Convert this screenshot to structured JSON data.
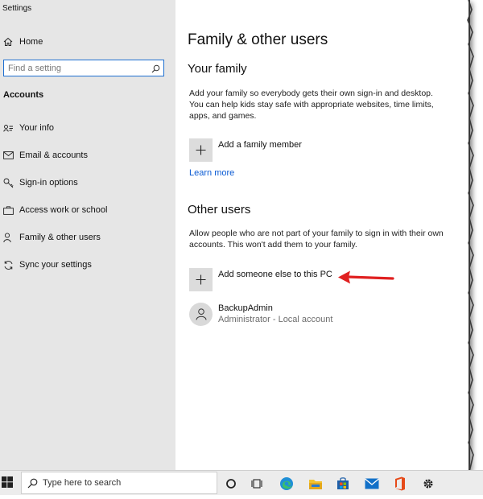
{
  "window": {
    "title": "Settings"
  },
  "sidebar": {
    "home": {
      "label": "Home",
      "icon": "home-icon"
    },
    "search": {
      "placeholder": "Find a setting",
      "icon": "search-icon"
    },
    "section": "Accounts",
    "items": [
      {
        "label": "Your info",
        "icon": "person-card-icon"
      },
      {
        "label": "Email & accounts",
        "icon": "mail-icon"
      },
      {
        "label": "Sign-in options",
        "icon": "key-icon"
      },
      {
        "label": "Access work or school",
        "icon": "briefcase-icon"
      },
      {
        "label": "Family & other users",
        "icon": "person-add-icon"
      },
      {
        "label": "Sync your settings",
        "icon": "sync-icon"
      }
    ]
  },
  "main": {
    "title": "Family & other users",
    "your_family": {
      "heading": "Your family",
      "description": "Add your family so everybody gets their own sign-in and desktop. You can help kids stay safe with appropriate websites, time limits, apps, and games.",
      "add_label": "Add a family member",
      "learn_more": "Learn more"
    },
    "other_users": {
      "heading": "Other users",
      "description": "Allow people who are not part of your family to sign in with their own accounts. This won't add them to your family.",
      "add_label": "Add someone else to this PC",
      "user": {
        "name": "BackupAdmin",
        "detail": "Administrator - Local account"
      }
    }
  },
  "annotation": {
    "arrow_color": "#e02020"
  },
  "taskbar": {
    "search_text": "Type here to search",
    "icons": [
      "windows-start-icon",
      "cortana-icon",
      "task-view-icon",
      "edge-icon",
      "file-explorer-icon",
      "store-icon",
      "mail-icon",
      "office-icon",
      "settings-icon"
    ]
  },
  "colors": {
    "sidebar_bg": "#e6e6e6",
    "accent": "#1f6fd1",
    "link": "#0b5bd3"
  }
}
